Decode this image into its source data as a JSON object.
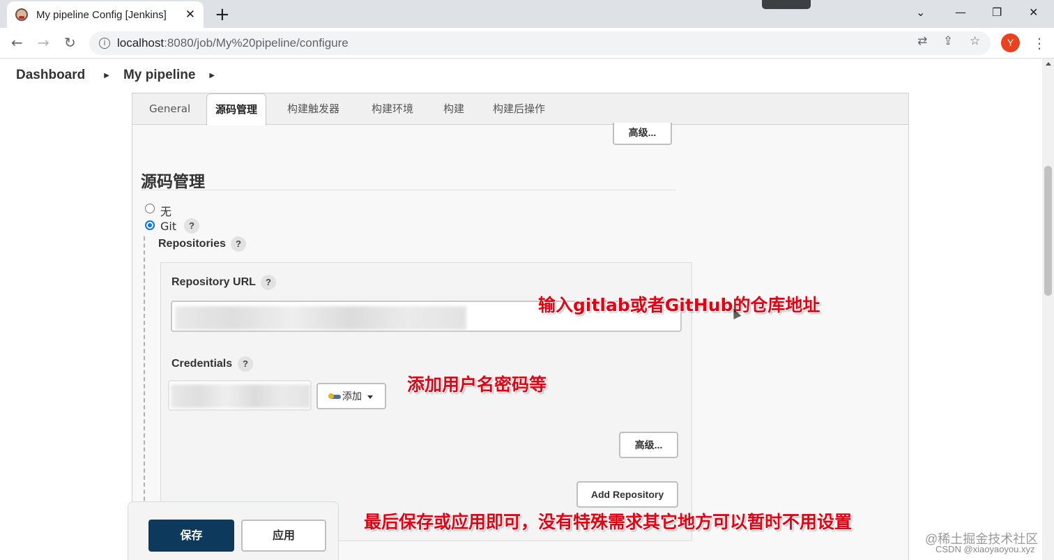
{
  "browser": {
    "tab_title": "My pipeline Config [Jenkins]",
    "url_host": "localhost",
    "url_path": ":8080/job/My%20pipeline/configure",
    "profile_initial": "Y"
  },
  "breadcrumbs": [
    "Dashboard",
    "My pipeline"
  ],
  "config_tabs": [
    "General",
    "源码管理",
    "构建触发器",
    "构建环境",
    "构建",
    "构建后操作"
  ],
  "active_tab": "源码管理",
  "section": {
    "advanced_top": "高级...",
    "title": "源码管理",
    "option_none": "无",
    "option_git": "Git",
    "repositories_label": "Repositories",
    "repo_url_label": "Repository URL",
    "credentials_label": "Credentials",
    "add_credentials_label": "添加",
    "advanced_repo": "高级...",
    "add_repository": "Add Repository",
    "help_mark": "?"
  },
  "footer": {
    "save": "保存",
    "apply": "应用"
  },
  "annotations": {
    "repo_url_note": "输入gitlab或者GitHub的仓库地址",
    "credentials_note": "添加用户名密码等",
    "final_note": "最后保存或应用即可，没有特殊需求其它地方可以暂时不用设置"
  },
  "watermarks": {
    "site": "@稀土掘金技术社区",
    "author": "CSDN @xiaoyaoyou.xyz"
  }
}
